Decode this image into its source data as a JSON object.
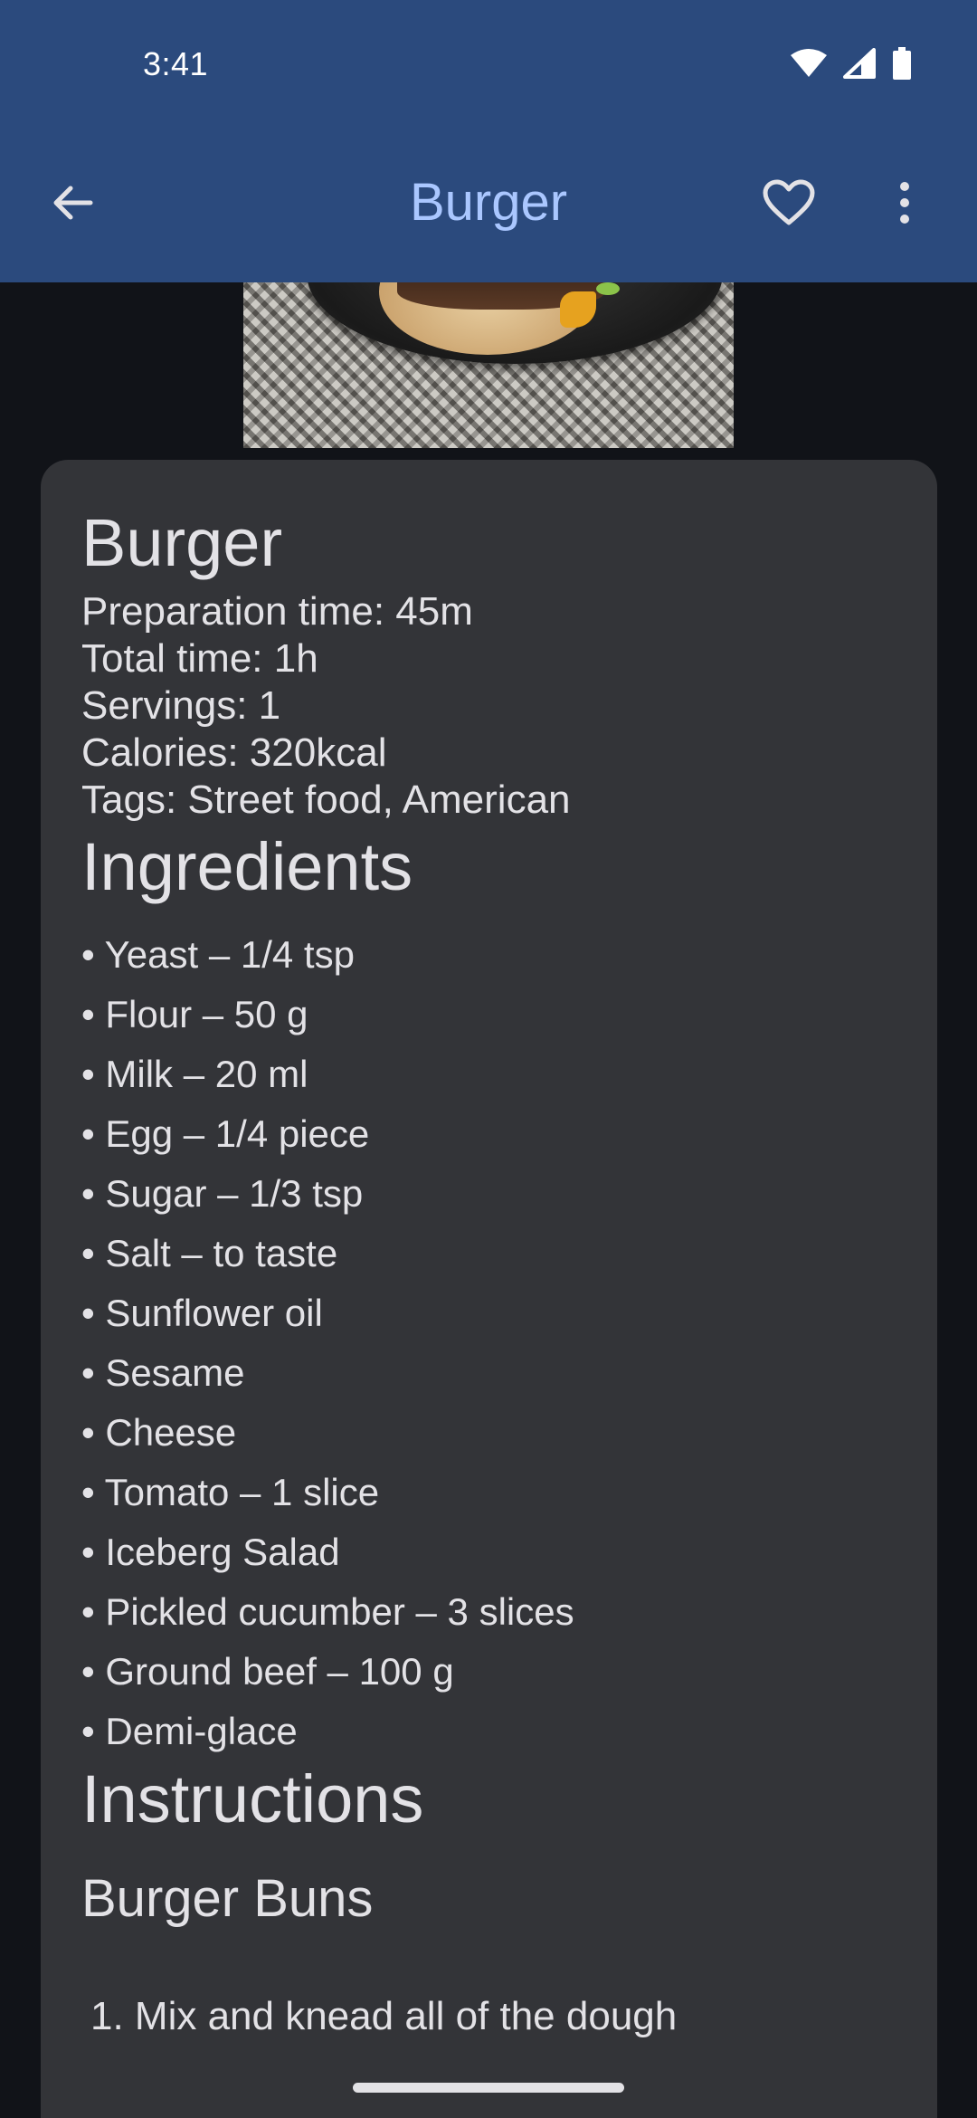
{
  "status_bar": {
    "time": "3:41",
    "icons": [
      "wifi-icon",
      "signal-icon",
      "battery-icon"
    ]
  },
  "toolbar": {
    "title": "Burger",
    "back_icon": "arrow-back-icon",
    "favorite_icon": "heart-outline-icon",
    "more_icon": "more-vert-icon"
  },
  "recipe": {
    "title": "Burger",
    "preparation_time": "Preparation time: 45m",
    "total_time": "Total time: 1h",
    "servings": "Servings: 1",
    "calories": "Calories: 320kcal",
    "tags": "Tags: Street food, American"
  },
  "ingredients": {
    "title": "Ingredients",
    "items": [
      "• Yeast – 1/4 tsp",
      "• Flour – 50 g",
      "• Milk – 20 ml",
      "• Egg – 1/4 piece",
      "• Sugar – 1/3 tsp",
      "• Salt – to taste",
      "• Sunflower oil",
      "• Sesame",
      "• Cheese",
      "• Tomato – 1 slice",
      "• Iceberg Salad",
      "• Pickled cucumber – 3 slices",
      "• Ground beef – 100 g",
      "• Demi-glace"
    ]
  },
  "instructions": {
    "title": "Instructions",
    "subsection": "Burger Buns",
    "first_step": "1. Mix and knead all of the dough"
  },
  "colors": {
    "app_bar": "#2b4a7d",
    "title_accent": "#aac7ff",
    "background": "#111318",
    "card": "#333438",
    "text": "#e3e2e6"
  }
}
